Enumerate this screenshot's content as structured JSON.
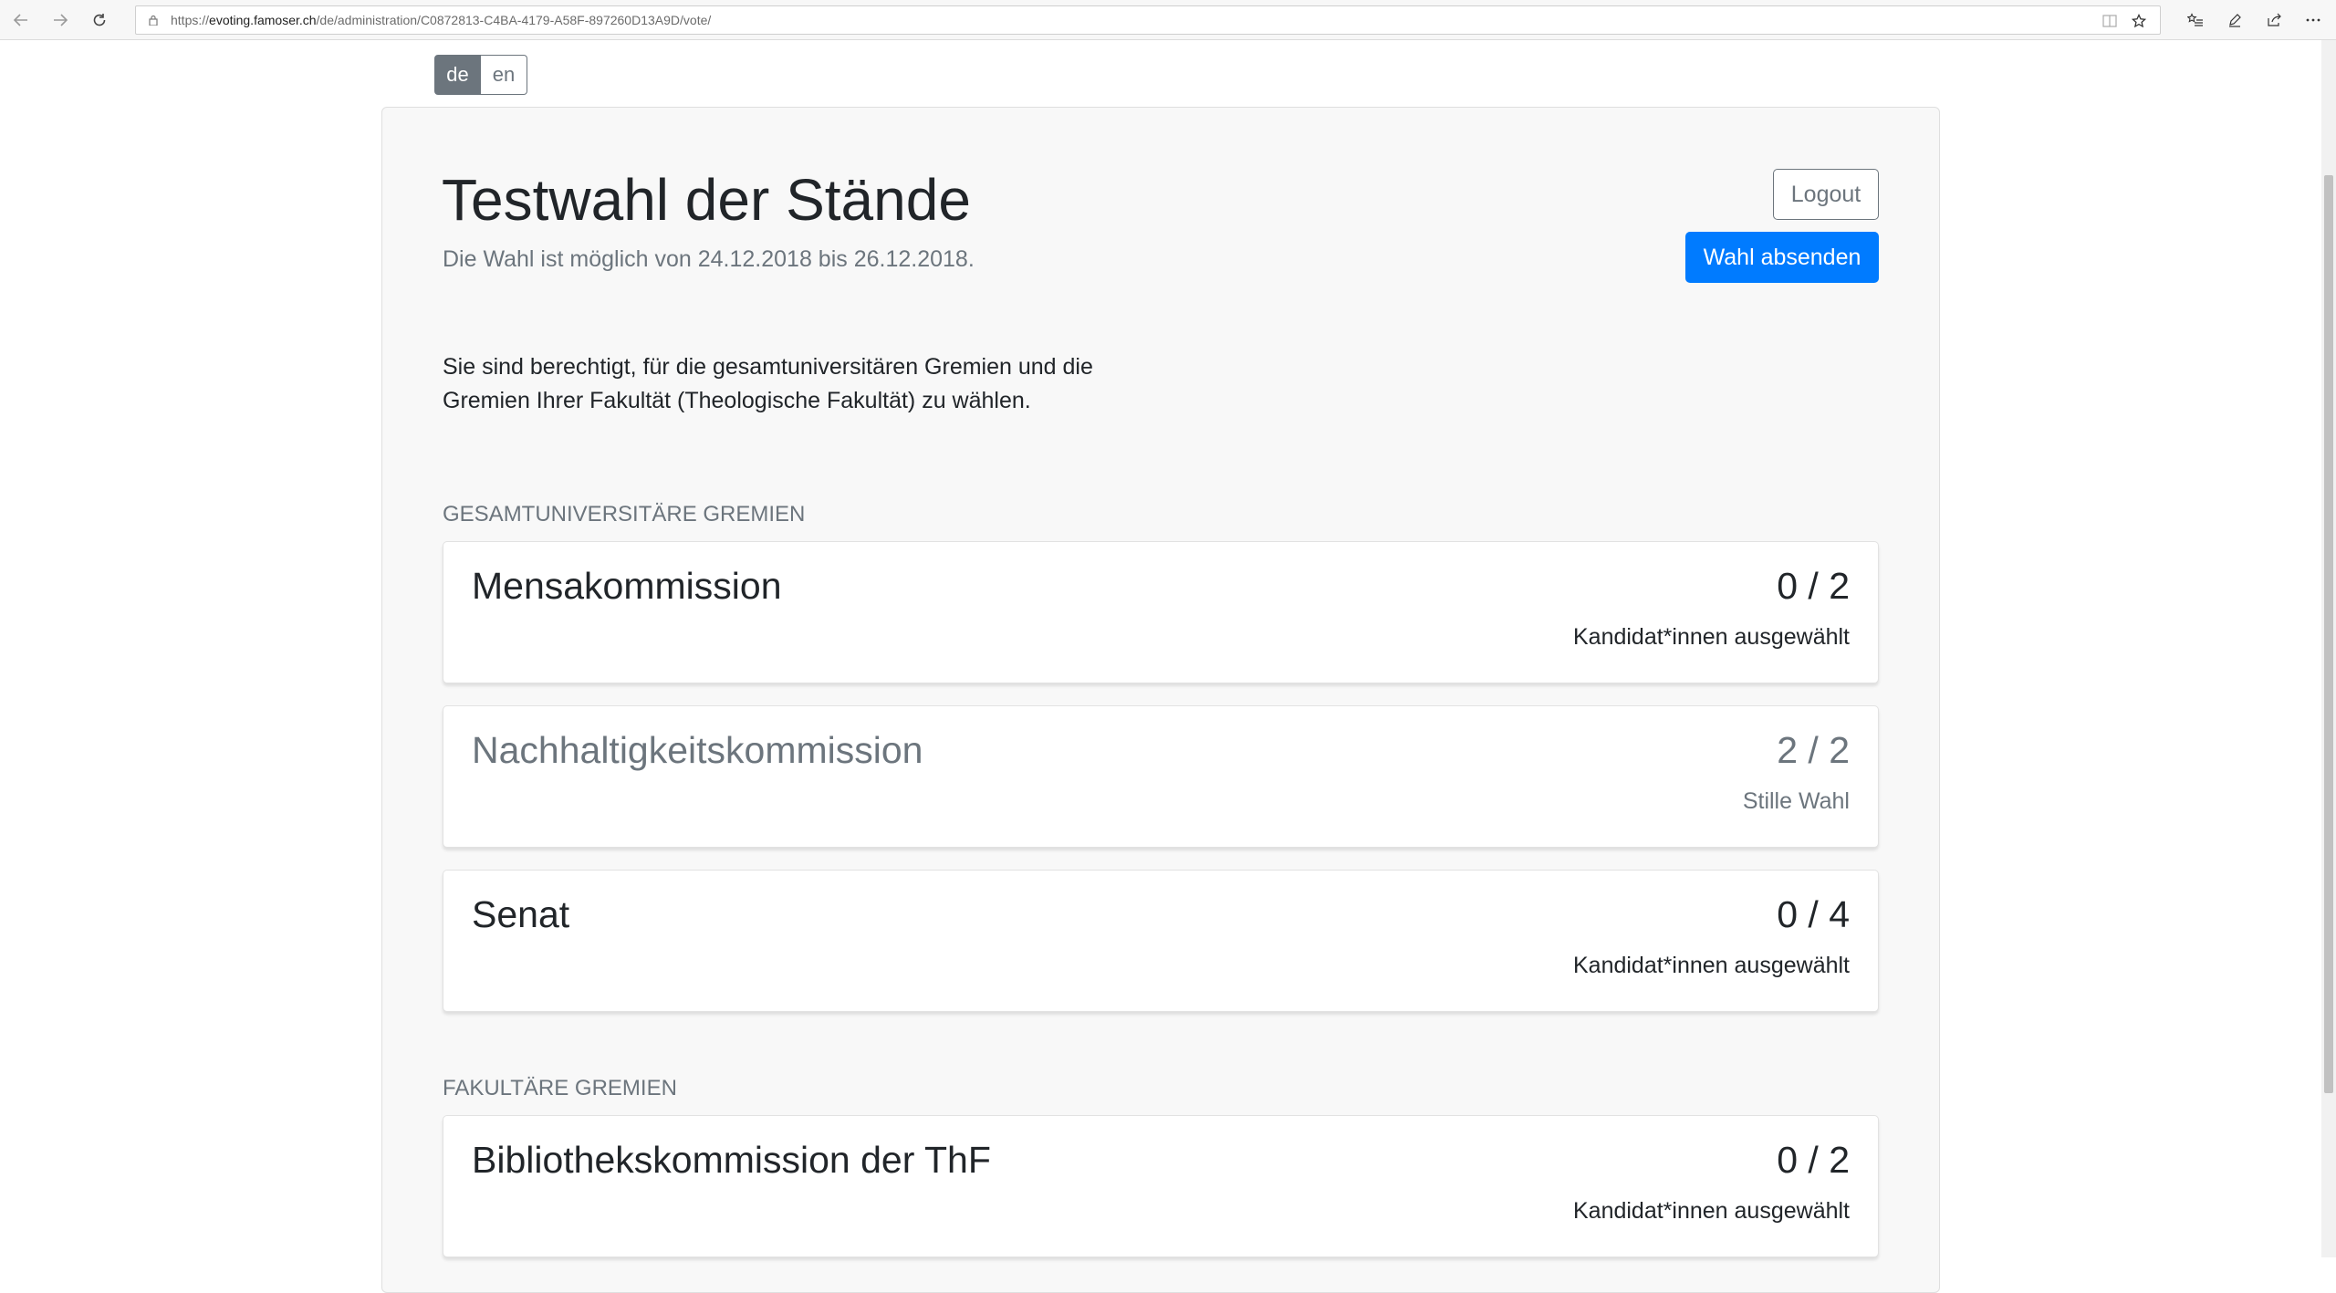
{
  "browser": {
    "url_prefix": "https://",
    "url_host": "evoting.famoser.ch",
    "url_path": "/de/administration/C0872813-C4BA-4179-A58F-897260D13A9D/vote/",
    "icons": [
      "back-icon",
      "forward-icon",
      "refresh-icon",
      "lock-icon",
      "reading-view-icon",
      "favorite-star-icon",
      "favorites-list-icon",
      "pen-icon",
      "share-icon",
      "more-icon"
    ]
  },
  "lang": {
    "de": "de",
    "en": "en"
  },
  "header": {
    "title": "Testwahl der Stände",
    "period": "Die Wahl ist möglich von 24.12.2018 bis 26.12.2018.",
    "logout_label": "Logout",
    "submit_label": "Wahl absenden"
  },
  "intro": {
    "text": "Sie sind berechtigt, für die gesamtuniversitären Gremien und die Gremien Ihrer Fakultät (Theologische Fakultät) zu wählen."
  },
  "sections": [
    {
      "heading": "Gesamtuniversitäre Gremien",
      "committees": [
        {
          "name": "Mensakommission",
          "count": "0 / 2",
          "status": "Kandidat*innen ausgewählt"
        },
        {
          "name": "Nachhaltigkeitskommission",
          "count": "2 / 2",
          "status": "Stille Wahl"
        },
        {
          "name": "Senat",
          "count": "0 / 4",
          "status": "Kandidat*innen ausgewählt"
        }
      ]
    },
    {
      "heading": "Fakultäre Gremien",
      "committees": [
        {
          "name": "Bibliothekskommission der ThF",
          "count": "0 / 2",
          "status": "Kandidat*innen ausgewählt"
        }
      ]
    }
  ],
  "colors": {
    "primary": "#007bff",
    "secondary": "#6c757d",
    "card_bg": "#f8f8f8"
  }
}
